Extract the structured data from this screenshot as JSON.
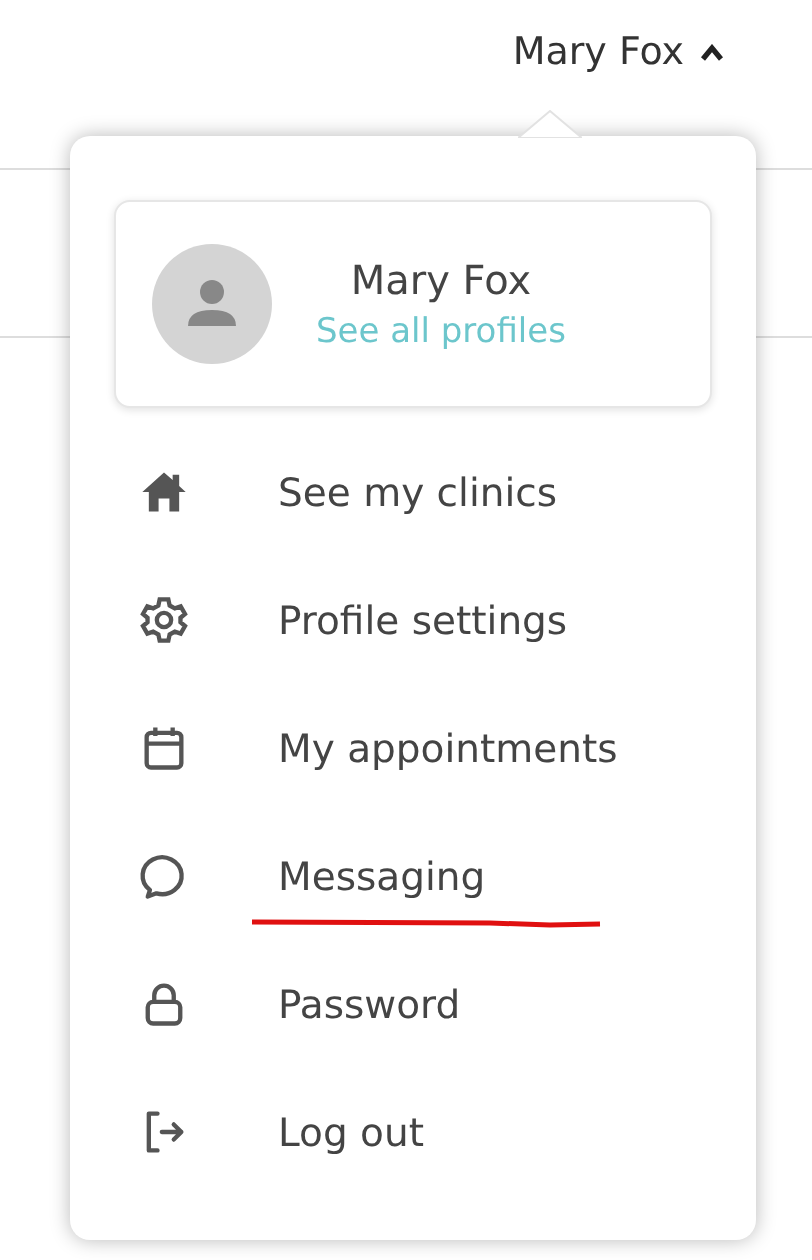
{
  "header": {
    "user_name": "Mary Fox",
    "expanded": true
  },
  "profile": {
    "name": "Mary Fox",
    "link": "See all profiles"
  },
  "menu_items": [
    {
      "label": "See my clinics",
      "underlined": false
    },
    {
      "label": "Profile settings",
      "underlined": false
    },
    {
      "label": "My appointments",
      "underlined": false
    },
    {
      "label": "Messaging",
      "underlined": true
    },
    {
      "label": "Password",
      "underlined": false
    },
    {
      "label": "Log out",
      "underlined": false
    }
  ]
}
